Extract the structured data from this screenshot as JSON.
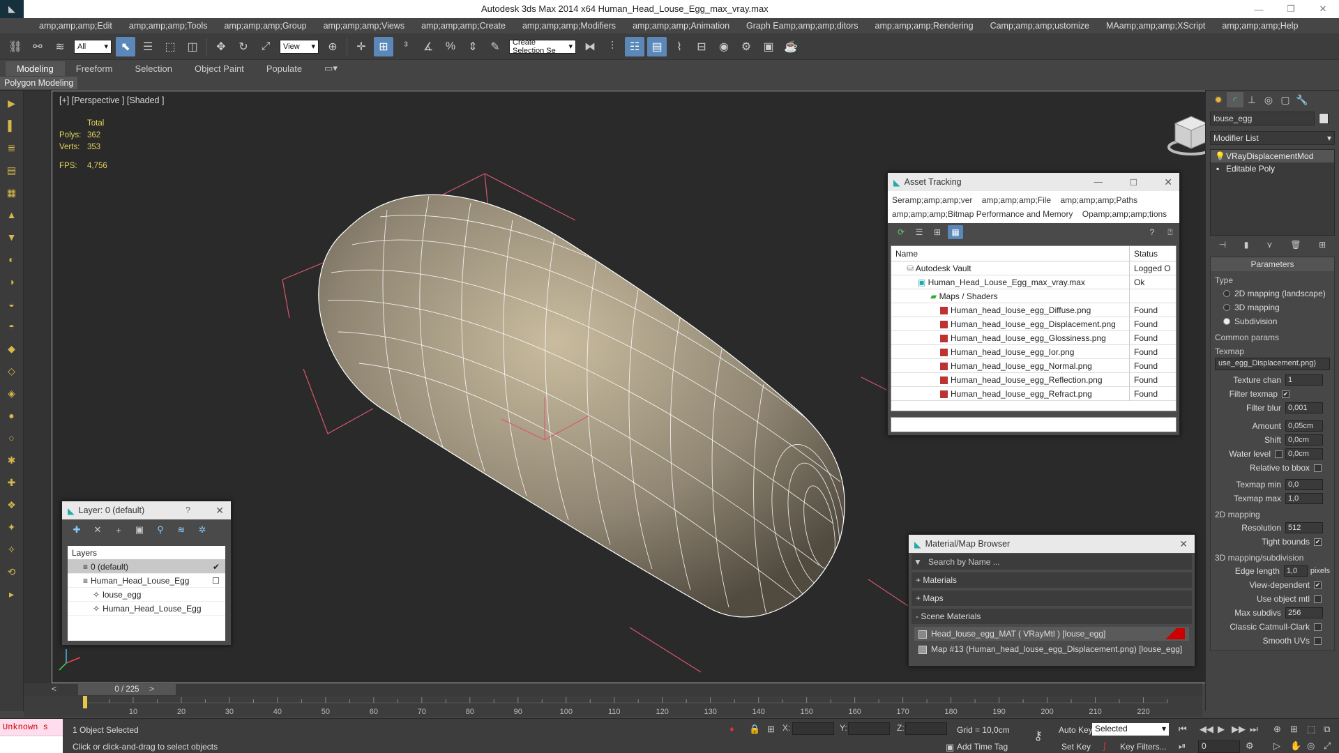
{
  "app": {
    "title": "Autodesk 3ds Max  2014 x64     Human_Head_Louse_Egg_max_vray.max"
  },
  "menu": [
    "amp;amp;amp;Edit",
    "amp;amp;amp;Tools",
    "amp;amp;amp;Group",
    "amp;amp;amp;Views",
    "amp;amp;amp;Create",
    "amp;amp;amp;Modifiers",
    "amp;amp;amp;Animation",
    "Graph Eamp;amp;amp;ditors",
    "amp;amp;amp;Rendering",
    "Camp;amp;amp;ustomize",
    "MAamp;amp;amp;XScript",
    "amp;amp;amp;Help"
  ],
  "toolbar": {
    "filter": "All",
    "refcoord": "View",
    "selection_set": "Create Selection Se"
  },
  "ribbon": {
    "tabs": [
      "Modeling",
      "Freeform",
      "Selection",
      "Object Paint",
      "Populate"
    ],
    "sub": "Polygon Modeling"
  },
  "viewport": {
    "label": "[+] [Perspective ] [Shaded ]",
    "total": "Total",
    "polys_label": "Polys:",
    "polys": "362",
    "verts_label": "Verts:",
    "verts": "353",
    "fps_label": "FPS:",
    "fps": "4,756"
  },
  "asset_tracking": {
    "title": "Asset Tracking",
    "menu1": [
      "Seramp;amp;amp;ver",
      "amp;amp;amp;File",
      "amp;amp;amp;Paths"
    ],
    "menu2": [
      "amp;amp;amp;Bitmap Performance and Memory",
      "Opamp;amp;amp;tions"
    ],
    "col_name": "Name",
    "col_status": "Status",
    "rows": [
      {
        "name": "Autodesk Vault",
        "status": "Logged O"
      },
      {
        "name": "Human_Head_Louse_Egg_max_vray.max",
        "status": "Ok"
      },
      {
        "name": "Maps / Shaders",
        "status": ""
      },
      {
        "name": "Human_head_louse_egg_Diffuse.png",
        "status": "Found"
      },
      {
        "name": "Human_head_louse_egg_Displacement.png",
        "status": "Found"
      },
      {
        "name": "Human_head_louse_egg_Glossiness.png",
        "status": "Found"
      },
      {
        "name": "Human_head_louse_egg_Ior.png",
        "status": "Found"
      },
      {
        "name": "Human_head_louse_egg_Normal.png",
        "status": "Found"
      },
      {
        "name": "Human_head_louse_egg_Reflection.png",
        "status": "Found"
      },
      {
        "name": "Human_head_louse_egg_Refract.png",
        "status": "Found"
      }
    ]
  },
  "layer_panel": {
    "title": "Layer: 0 (default)",
    "help": "?",
    "header": "Layers",
    "rows": [
      "0 (default)",
      "Human_Head_Louse_Egg",
      "louse_egg",
      "Human_Head_Louse_Egg"
    ]
  },
  "material_browser": {
    "title": "Material/Map Browser",
    "search_placeholder": "Search by Name ...",
    "groups": [
      "+ Materials",
      "+ Maps",
      "- Scene Materials"
    ],
    "materials": [
      "Head_louse_egg_MAT ( VRayMtl ) [louse_egg]",
      "Map #13 (Human_head_louse_egg_Displacement.png) [louse_egg]"
    ]
  },
  "command_panel": {
    "object_name": "louse_egg",
    "modifier_list": "Modifier List",
    "stack": [
      "VRayDisplacementMod",
      "Editable Poly"
    ],
    "params_title": "Parameters",
    "type_label": "Type",
    "types": [
      "2D mapping (landscape)",
      "3D mapping",
      "Subdivision"
    ],
    "common_label": "Common params",
    "texmap_label": "Texmap",
    "texmap_value": "use_egg_Displacement.png)",
    "texture_chan_label": "Texture chan",
    "texture_chan": "1",
    "filter_texmap_label": "Filter texmap",
    "filter_blur_label": "Filter blur",
    "filter_blur": "0,001",
    "amount_label": "Amount",
    "amount": "0,05cm",
    "shift_label": "Shift",
    "shift": "0,0cm",
    "water_label": "Water level",
    "water": "0,0cm",
    "rel_bbox_label": "Relative to bbox",
    "texmap_min_label": "Texmap min",
    "texmap_min": "0,0",
    "texmap_max_label": "Texmap max",
    "texmap_max": "1,0",
    "mapping2d_label": "2D mapping",
    "resolution_label": "Resolution",
    "resolution": "512",
    "tight_label": "Tight bounds",
    "mapping3d_label": "3D mapping/subdivision",
    "edge_label": "Edge length",
    "edge": "1,0",
    "pixels_label": "pixels",
    "view_dep_label": "View-dependent",
    "use_obj_label": "Use object mtl",
    "max_subdivs_label": "Max subdivs",
    "max_subdivs": "256",
    "catmull_label": "Classic Catmull-Clark",
    "smooth_uv_label": "Smooth UVs"
  },
  "timeline": {
    "frame": "0 / 225",
    "ticks": [
      "10",
      "20",
      "30",
      "40",
      "50",
      "60",
      "70",
      "80",
      "90",
      "100",
      "110",
      "120",
      "130",
      "140",
      "150",
      "160",
      "170",
      "180",
      "190",
      "200",
      "210",
      "220"
    ]
  },
  "status": {
    "maxscript": "Unknown s",
    "selected": "1 Object Selected",
    "prompt": "Click or click-and-drag to select objects",
    "x_label": "X:",
    "y_label": "Y:",
    "z_label": "Z:",
    "grid": "Grid = 10,0cm",
    "auto_key": "Auto Key",
    "selected_dd": "Selected",
    "set_key": "Set Key",
    "key_filters": "Key Filters...",
    "add_time_tag": "Add Time Tag",
    "frame_field": "0"
  }
}
